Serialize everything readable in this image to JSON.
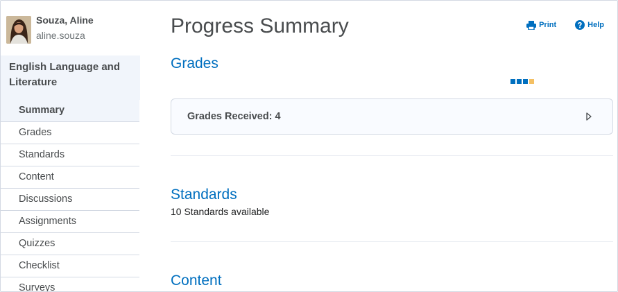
{
  "user": {
    "name": "Souza, Aline",
    "username": "aline.souza"
  },
  "course": {
    "title": "English Language and Literature"
  },
  "nav": {
    "items": [
      {
        "label": "Summary",
        "active": true
      },
      {
        "label": "Grades"
      },
      {
        "label": "Standards"
      },
      {
        "label": "Content"
      },
      {
        "label": "Discussions"
      },
      {
        "label": "Assignments"
      },
      {
        "label": "Quizzes"
      },
      {
        "label": "Checklist"
      },
      {
        "label": "Surveys"
      }
    ]
  },
  "page": {
    "title": "Progress Summary"
  },
  "toolbar": {
    "print_label": "Print",
    "help_label": "Help",
    "print_icon": "print-icon",
    "help_icon": "help-icon"
  },
  "grades": {
    "title": "Grades",
    "received_label": "Grades Received: 4"
  },
  "standards": {
    "title": "Standards",
    "available_text": "10 Standards available"
  },
  "content": {
    "title": "Content"
  },
  "colors": {
    "accent": "#006fbf",
    "active_bg": "#f1f5fb",
    "loader_highlight": "#f4c064"
  }
}
